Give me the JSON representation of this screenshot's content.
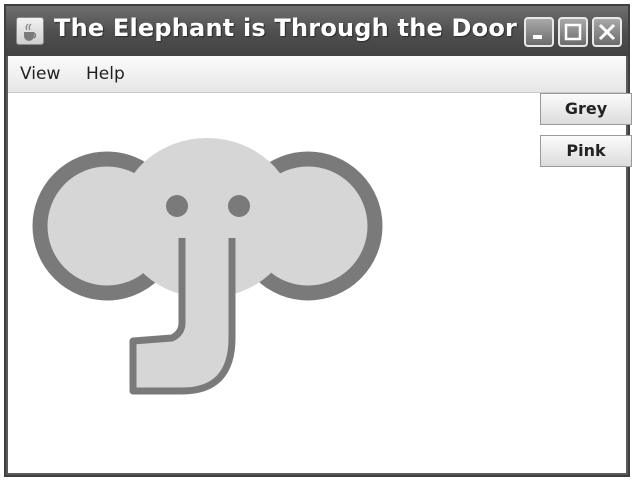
{
  "window": {
    "title": "The Elephant is Through the Door",
    "app_icon": "java-cup-icon",
    "controls": [
      "minimize-icon",
      "maximize-icon",
      "close-icon"
    ]
  },
  "menubar": {
    "items": [
      {
        "label": "View"
      },
      {
        "label": "Help"
      }
    ]
  },
  "buttons": {
    "grey_label": "Grey",
    "pink_label": "Pink"
  },
  "colors": {
    "elephant_fill": "#d6d6d6",
    "elephant_outline": "#7a7a7a"
  }
}
